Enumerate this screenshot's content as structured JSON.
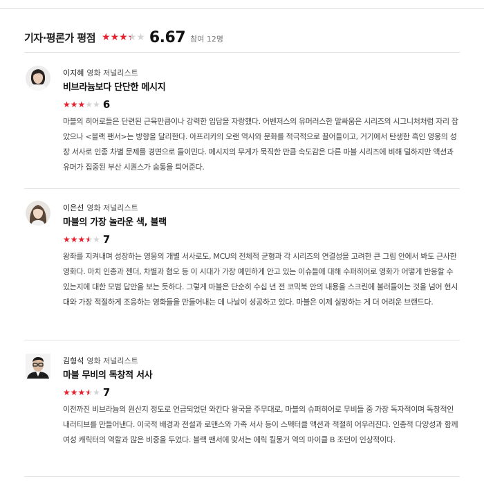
{
  "header": {
    "title": "기자·평론가 평점",
    "avg_score": "6.67",
    "avg_fraction": 0.667,
    "participants": "참여 12명"
  },
  "colors": {
    "star_on": "#e8212f",
    "star_off": "#d4d4d4"
  },
  "reviews": [
    {
      "avatar": "woman-short-hair-photo",
      "name": "이지혜",
      "role": "영화 저널리스트",
      "headline": "비브라늄보다 단단한 메시지",
      "score": "6",
      "stars_fraction": 0.6,
      "body": "마블의 히어로들은 단련된 근육만큼이나 강력한 입담을 자랑했다. 어벤저스의 유머러스한 말싸움은 시리즈의 시그니처처럼 자리 잡았으나 <블랙 팬서>는 방향을 달리한다. 아프리카의 오랜 역사와 문화를 적극적으로 끌어들이고, 거기에서 탄생한 흑인 영웅의 성장 서사로 인종 차별 문제를 경면으로 들이민다. 메시지의 무게가 묵직한 만큼 속도감은 다른 마블 시리즈에 비해 덜하지만 액션과 유머가 집중된 부산 시퀀스가 숨통을 틔어준다."
    },
    {
      "avatar": "woman-long-hair-photo",
      "name": "이은선",
      "role": "영화 저널리스트",
      "headline": "마블의 가장 놀라운 색, 블랙",
      "score": "7",
      "stars_fraction": 0.7,
      "body": "왕좌를 지켜내며 성장하는 영웅의 개별 서사로도, MCU의 전체적 균형과 각 시리즈의 연결성을 고려한 큰 그림 안에서 봐도 근사한 영화다. 마치 인종과 젠더, 차별과 혐오 등 이 시대가 가장 예민하게 안고 있는 이슈들에 대해 수퍼히어로 영화가 어떻게 반응할 수 있는지에 대한 모범 답안을 보는 듯하다. 그렇게 마블은 단순히 수십 년 전 코믹북 안의 내용을 스크린에 불러들이는 것을 넘어 현시대와 가장 적절하게 조응하는 영화들을 만들어내는 데 나날이 성공하고 있다. 마블은 이제 실망하는 게 더 어려운 브랜드다."
    },
    {
      "avatar": "man-glasses-photo",
      "name": "김형석",
      "role": "영화 저널리스트",
      "headline": "마블 무비의 독창적 서사",
      "score": "7",
      "stars_fraction": 0.7,
      "body": "이전까진 비브라늄의 원산지 정도로 언급되었던 와칸다 왕국을 주무대로, 마블의 슈퍼히어로 무비들 중 가장 독자적이며 독창적인 내러티브를 만들어낸다. 이국적 배경과 전설과 로맨스와 가족 서사 등이 스펙터클 액션과 적절히 어우러진다. 인종적 다양성과 함께 여성 캐릭터의 역할과 많은 비중을 두었다. 블랙 팬서에 맞서는 에릭 킬몽거 역의 마이클 B 조던이 인상적이다."
    }
  ]
}
